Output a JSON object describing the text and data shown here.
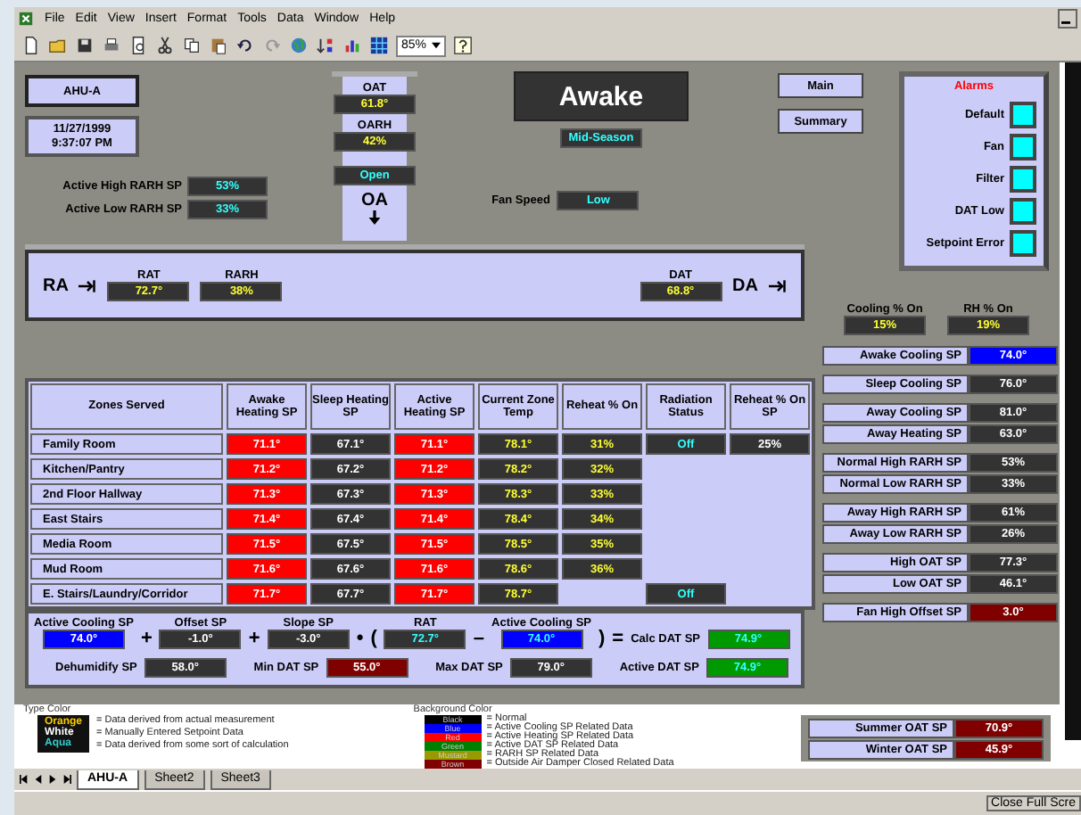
{
  "menu": [
    "File",
    "Edit",
    "View",
    "Insert",
    "Format",
    "Tools",
    "Data",
    "Window",
    "Help"
  ],
  "toolbar": {
    "zoom": "85%"
  },
  "unit": {
    "name": "AHU-A",
    "date": "11/27/1999",
    "time": "9:37:07 PM"
  },
  "humidity_setpoints": [
    {
      "label": "Active High RARH SP",
      "value": {
        "text": "53%",
        "color": "#333333",
        "kind": "calculated"
      }
    },
    {
      "label": "Active Low RARH SP",
      "value": {
        "text": "33%",
        "color": "#333333",
        "kind": "calculated"
      }
    }
  ],
  "outdoor": {
    "readings": [
      {
        "label": "OAT",
        "value": {
          "text": "61.8°",
          "color": "#333333",
          "kind": "measured"
        }
      },
      {
        "label": "OARH",
        "value": {
          "text": "42%",
          "color": "#333333",
          "kind": "measured"
        }
      }
    ],
    "damper": {
      "text": "Open",
      "color": "#333333",
      "kind": "calculated"
    },
    "label": "OA"
  },
  "mode": {
    "title": "Awake",
    "season": {
      "text": "Mid-Season",
      "color": "#333333",
      "kind": "calculated"
    }
  },
  "fan_speed": {
    "label": "Fan Speed",
    "value": {
      "text": "Low",
      "color": "#333333",
      "kind": "calculated"
    }
  },
  "nav_buttons": [
    "Main",
    "Summary"
  ],
  "alarms": {
    "title": "Alarms",
    "items": [
      {
        "label": "Default",
        "active": false
      },
      {
        "label": "Fan",
        "active": false
      },
      {
        "label": "Filter",
        "active": false
      },
      {
        "label": "DAT Low",
        "active": false
      },
      {
        "label": "Setpoint Error",
        "active": false
      }
    ]
  },
  "return_air": {
    "label": "RA",
    "readings": [
      {
        "label": "RAT",
        "value": {
          "text": "72.7°",
          "color": "#333333",
          "kind": "measured"
        }
      },
      {
        "label": "RARH",
        "value": {
          "text": "38%",
          "color": "#333333",
          "kind": "measured"
        }
      }
    ]
  },
  "discharge_air": {
    "label": "DA",
    "readings": [
      {
        "label": "DAT",
        "value": {
          "text": "68.8°",
          "color": "#333333",
          "kind": "measured"
        }
      }
    ]
  },
  "outputs": [
    {
      "label": "Cooling % On",
      "value": {
        "text": "15%",
        "color": "#333333",
        "kind": "measured"
      }
    },
    {
      "label": "RH % On",
      "value": {
        "text": "19%",
        "color": "#333333",
        "kind": "measured"
      }
    }
  ],
  "zones": {
    "name_column": "Zones Served",
    "columns": [
      "Awake Heating SP",
      "Sleep Heating SP",
      "Active Heating SP",
      "Current Zone Temp",
      "Reheat % On",
      "Radiation Status",
      "Reheat % On SP"
    ],
    "rows": [
      {
        "name": "Family Room",
        "cells": [
          {
            "text": "71.1°",
            "color": "#ff0000",
            "kind": "setpoint"
          },
          {
            "text": "67.1°",
            "color": "#333333",
            "kind": "setpoint"
          },
          {
            "text": "71.1°",
            "color": "#ff0000",
            "kind": "setpoint"
          },
          {
            "text": "78.1°",
            "color": "#333333",
            "kind": "measured"
          },
          {
            "text": "31%",
            "color": "#333333",
            "kind": "measured"
          },
          {
            "text": "Off",
            "color": "#333333",
            "kind": "calculated"
          },
          {
            "text": "25%",
            "color": "#333333",
            "kind": "setpoint"
          }
        ]
      },
      {
        "name": "Kitchen/Pantry",
        "cells": [
          {
            "text": "71.2°",
            "color": "#ff0000",
            "kind": "setpoint"
          },
          {
            "text": "67.2°",
            "color": "#333333",
            "kind": "setpoint"
          },
          {
            "text": "71.2°",
            "color": "#ff0000",
            "kind": "setpoint"
          },
          {
            "text": "78.2°",
            "color": "#333333",
            "kind": "measured"
          },
          {
            "text": "32%",
            "color": "#333333",
            "kind": "measured"
          },
          null,
          null
        ]
      },
      {
        "name": "2nd Floor Hallway",
        "cells": [
          {
            "text": "71.3°",
            "color": "#ff0000",
            "kind": "setpoint"
          },
          {
            "text": "67.3°",
            "color": "#333333",
            "kind": "setpoint"
          },
          {
            "text": "71.3°",
            "color": "#ff0000",
            "kind": "setpoint"
          },
          {
            "text": "78.3°",
            "color": "#333333",
            "kind": "measured"
          },
          {
            "text": "33%",
            "color": "#333333",
            "kind": "measured"
          },
          null,
          null
        ]
      },
      {
        "name": "East Stairs",
        "cells": [
          {
            "text": "71.4°",
            "color": "#ff0000",
            "kind": "setpoint"
          },
          {
            "text": "67.4°",
            "color": "#333333",
            "kind": "setpoint"
          },
          {
            "text": "71.4°",
            "color": "#ff0000",
            "kind": "setpoint"
          },
          {
            "text": "78.4°",
            "color": "#333333",
            "kind": "measured"
          },
          {
            "text": "34%",
            "color": "#333333",
            "kind": "measured"
          },
          null,
          null
        ]
      },
      {
        "name": "Media Room",
        "cells": [
          {
            "text": "71.5°",
            "color": "#ff0000",
            "kind": "setpoint"
          },
          {
            "text": "67.5°",
            "color": "#333333",
            "kind": "setpoint"
          },
          {
            "text": "71.5°",
            "color": "#ff0000",
            "kind": "setpoint"
          },
          {
            "text": "78.5°",
            "color": "#333333",
            "kind": "measured"
          },
          {
            "text": "35%",
            "color": "#333333",
            "kind": "measured"
          },
          null,
          null
        ]
      },
      {
        "name": "Mud Room",
        "cells": [
          {
            "text": "71.6°",
            "color": "#ff0000",
            "kind": "setpoint"
          },
          {
            "text": "67.6°",
            "color": "#333333",
            "kind": "setpoint"
          },
          {
            "text": "71.6°",
            "color": "#ff0000",
            "kind": "setpoint"
          },
          {
            "text": "78.6°",
            "color": "#333333",
            "kind": "measured"
          },
          {
            "text": "36%",
            "color": "#333333",
            "kind": "measured"
          },
          null,
          null
        ]
      },
      {
        "name": "E. Stairs/Laundry/Corridor",
        "cells": [
          {
            "text": "71.7°",
            "color": "#ff0000",
            "kind": "setpoint"
          },
          {
            "text": "67.7°",
            "color": "#333333",
            "kind": "setpoint"
          },
          {
            "text": "71.7°",
            "color": "#ff0000",
            "kind": "setpoint"
          },
          {
            "text": "78.7°",
            "color": "#333333",
            "kind": "measured"
          },
          null,
          {
            "text": "Off",
            "color": "#333333",
            "kind": "calculated"
          },
          null
        ]
      }
    ]
  },
  "formula": {
    "top_line": [
      {
        "kind": "term",
        "label": "Active Cooling SP",
        "value": {
          "text": "74.0°",
          "color": "#0000ff",
          "kind": "setpoint"
        }
      },
      {
        "kind": "op",
        "text": "+"
      },
      {
        "kind": "term",
        "label": "Offset SP",
        "value": {
          "text": "-1.0°",
          "color": "#333333",
          "kind": "setpoint"
        }
      },
      {
        "kind": "op",
        "text": "+"
      },
      {
        "kind": "term",
        "label": "Slope SP",
        "value": {
          "text": "-3.0°",
          "color": "#333333",
          "kind": "setpoint"
        }
      },
      {
        "kind": "op",
        "text": "•"
      },
      {
        "kind": "op",
        "text": "("
      },
      {
        "kind": "term",
        "label": "RAT",
        "value": {
          "text": "72.7°",
          "color": "#333333",
          "kind": "calculated"
        }
      },
      {
        "kind": "op",
        "text": "–"
      },
      {
        "kind": "term",
        "label": "Active Cooling SP",
        "value": {
          "text": "74.0°",
          "color": "#0000ff",
          "kind": "calculated"
        }
      },
      {
        "kind": "op",
        "text": ")"
      },
      {
        "kind": "op",
        "text": "="
      },
      {
        "kind": "inline",
        "label": "Calc DAT SP",
        "value": {
          "text": "74.9°",
          "color": "#009900",
          "kind": "calculated"
        }
      }
    ],
    "bottom_line": [
      {
        "kind": "inline",
        "label": "Dehumidify SP",
        "value": {
          "text": "58.0°",
          "color": "#333333",
          "kind": "setpoint"
        }
      },
      {
        "kind": "inline",
        "label": "Min DAT SP",
        "value": {
          "text": "55.0°",
          "color": "#800000",
          "kind": "setpoint"
        }
      },
      {
        "kind": "inline",
        "label": "Max DAT SP",
        "value": {
          "text": "79.0°",
          "color": "#333333",
          "kind": "setpoint"
        }
      },
      {
        "kind": "inline",
        "label": "Active DAT SP",
        "value": {
          "text": "74.9°",
          "color": "#009900",
          "kind": "calculated"
        }
      }
    ]
  },
  "setpoint_groups": [
    [
      {
        "label": "Awake Cooling SP",
        "value": {
          "text": "74.0°",
          "color": "#0000ff",
          "kind": "setpoint"
        }
      }
    ],
    [
      {
        "label": "Sleep Cooling SP",
        "value": {
          "text": "76.0°",
          "color": "#333333",
          "kind": "setpoint"
        }
      }
    ],
    [
      {
        "label": "Away Cooling SP",
        "value": {
          "text": "81.0°",
          "color": "#333333",
          "kind": "setpoint"
        }
      },
      {
        "label": "Away Heating SP",
        "value": {
          "text": "63.0°",
          "color": "#333333",
          "kind": "setpoint"
        }
      }
    ],
    [
      {
        "label": "Normal High RARH SP",
        "value": {
          "text": "53%",
          "color": "#333333",
          "kind": "setpoint"
        }
      },
      {
        "label": "Normal Low RARH SP",
        "value": {
          "text": "33%",
          "color": "#333333",
          "kind": "setpoint"
        }
      }
    ],
    [
      {
        "label": "Away High RARH SP",
        "value": {
          "text": "61%",
          "color": "#333333",
          "kind": "setpoint"
        }
      },
      {
        "label": "Away Low RARH SP",
        "value": {
          "text": "26%",
          "color": "#333333",
          "kind": "setpoint"
        }
      }
    ],
    [
      {
        "label": "High OAT SP",
        "value": {
          "text": "77.3°",
          "color": "#333333",
          "kind": "setpoint"
        }
      },
      {
        "label": "Low OAT SP",
        "value": {
          "text": "46.1°",
          "color": "#333333",
          "kind": "setpoint"
        }
      }
    ],
    [
      {
        "label": "Fan High Offset SP",
        "value": {
          "text": "3.0°",
          "color": "#800000",
          "kind": "setpoint"
        }
      }
    ]
  ],
  "legend": {
    "type_title": "Type Color",
    "types": [
      {
        "label": "Orange",
        "color": "#ffcc00",
        "text": "= Data derived from actual measurement"
      },
      {
        "label": "White",
        "color": "#ffffff",
        "text": "= Manually Entered Setpoint Data"
      },
      {
        "label": "Aqua",
        "color": "#33cccc",
        "text": "= Data derived from some sort of calculation"
      }
    ],
    "background_title": "Background Color",
    "backgrounds": [
      {
        "label": "Black",
        "color": "#000000",
        "text": "= Normal"
      },
      {
        "label": "Blue",
        "color": "#0000ff",
        "text": "= Active Cooling SP Related Data"
      },
      {
        "label": "Red",
        "color": "#ff0000",
        "text": "= Active Heating SP Related Data"
      },
      {
        "label": "Green",
        "color": "#008000",
        "text": "= Active DAT SP Related Data"
      },
      {
        "label": "Mustard",
        "color": "#999900",
        "text": "= RARH SP Related Data"
      },
      {
        "label": "Brown",
        "color": "#800000",
        "text": "= Outside Air Damper Closed Related Data"
      }
    ]
  },
  "seasonal_setpoints": [
    {
      "label": "Summer OAT SP",
      "value": {
        "text": "70.9°",
        "color": "#800000",
        "kind": "setpoint"
      }
    },
    {
      "label": "Winter OAT SP",
      "value": {
        "text": "45.9°",
        "color": "#800000",
        "kind": "setpoint"
      }
    }
  ],
  "sheet_tabs": [
    {
      "label": "AHU-A",
      "selected": true
    },
    {
      "label": "Sheet2",
      "selected": false
    },
    {
      "label": "Sheet3",
      "selected": false
    }
  ],
  "status_bar": {
    "button": "Close Full Scre"
  }
}
